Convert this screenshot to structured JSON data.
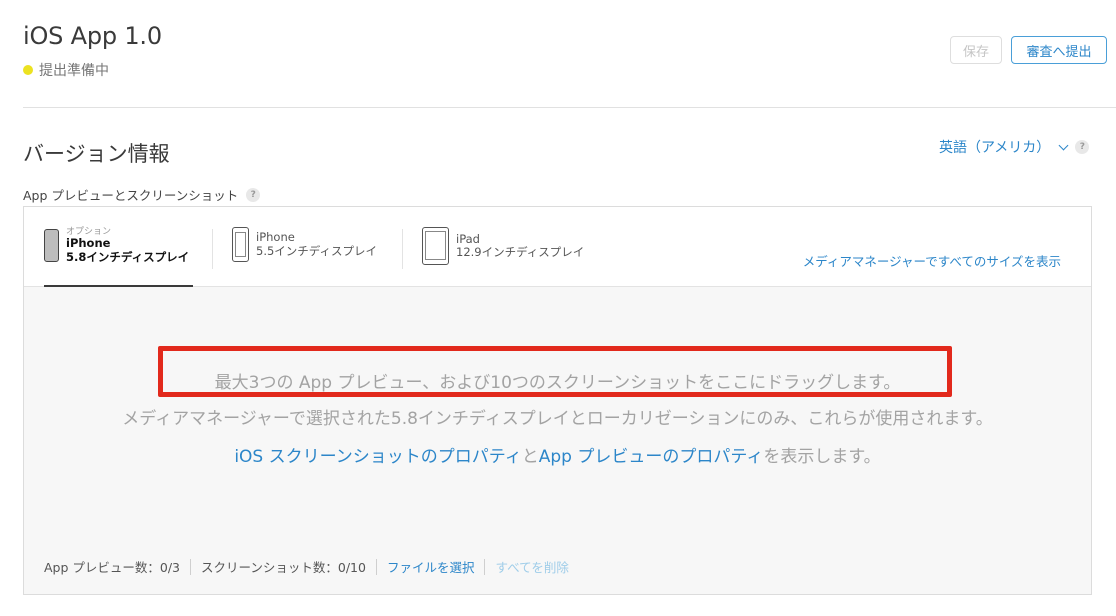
{
  "header": {
    "app_title": "iOS App 1.0",
    "status": "提出準備中",
    "save_label": "保存",
    "submit_label": "審査へ提出"
  },
  "section": {
    "title": "バージョン情報",
    "language": "英語（アメリカ）",
    "help_glyph": "?",
    "subsection_label": "App プレビューとスクリーンショット"
  },
  "tabs": [
    {
      "optional": "オプション",
      "device": "iPhone",
      "size": "5.8インチディスプレイ",
      "icon": "phone-icon"
    },
    {
      "device": "iPhone",
      "size": "5.5インチディスプレイ",
      "icon": "phone-icon"
    },
    {
      "device": "iPad",
      "size": "12.9インチディスプレイ",
      "icon": "ipad-icon"
    }
  ],
  "media_link": "メディアマネージャーですべてのサイズを表示",
  "dropzone": {
    "line1": "最大3つの App プレビュー、および10つのスクリーンショットをここにドラッグします。",
    "line2": "メディアマネージャーで選択された5.8インチディスプレイとローカリゼーションにのみ、これらが使用されます。",
    "line3_link1": "iOS スクリーンショットのプロパティ",
    "line3_text1": "と",
    "line3_link2": "App プレビューのプロパティ",
    "line3_text2": "を表示します。"
  },
  "footer": {
    "preview_count": "App プレビュー数：0/3",
    "screenshot_count": "スクリーンショット数：0/10",
    "choose_file": "ファイルを選択",
    "delete_all": "すべてを削除"
  },
  "colors": {
    "accent": "#2c86c9",
    "status_dot": "#ece221",
    "highlight": "#e2291c"
  }
}
